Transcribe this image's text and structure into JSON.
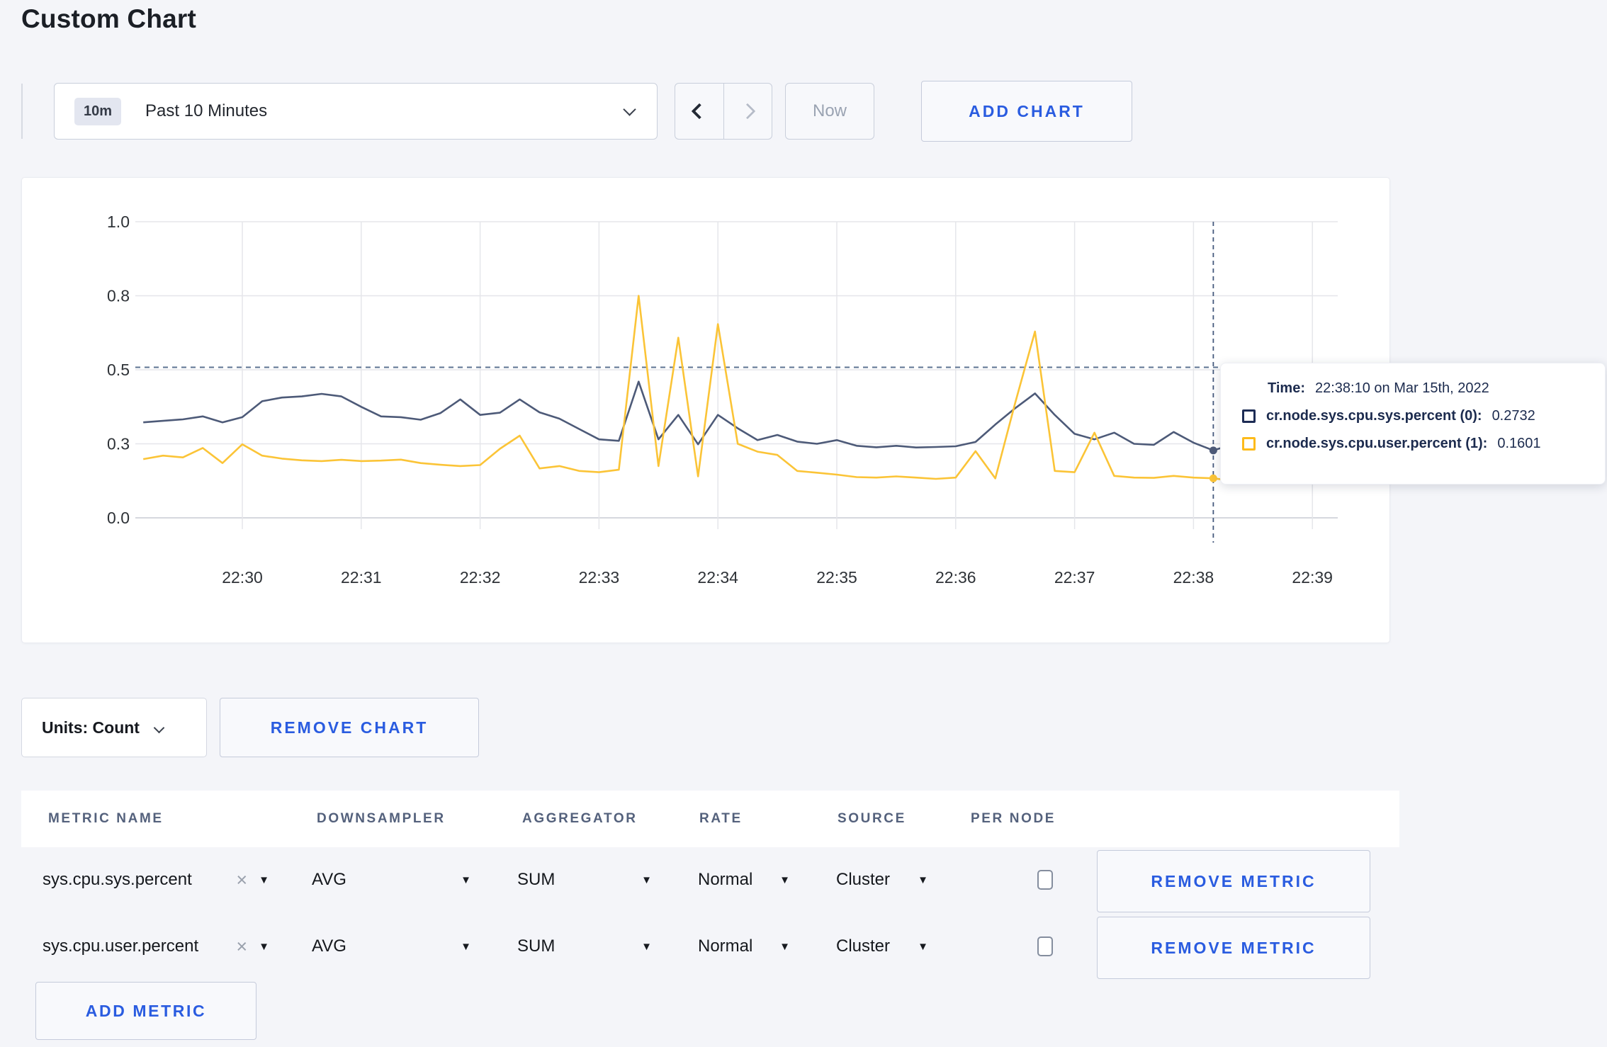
{
  "page": {
    "title": "Custom Chart"
  },
  "toolbar": {
    "time_window_badge": "10m",
    "time_window_label": "Past 10 Minutes",
    "now_label": "Now",
    "add_chart_label": "ADD CHART"
  },
  "tooltip": {
    "time_label": "Time:",
    "time_value": "22:38:10 on Mar 15th, 2022",
    "rows": [
      {
        "name": "cr.node.sys.cpu.sys.percent (0):",
        "value": "0.2732",
        "swatch": "#1d2c55"
      },
      {
        "name": "cr.node.sys.cpu.user.percent (1):",
        "value": "0.1601",
        "swatch": "#fdbb1b"
      }
    ]
  },
  "chart_controls": {
    "units_label": "Units: Count",
    "remove_chart_label": "REMOVE CHART"
  },
  "metrics_table": {
    "columns": [
      "Metric Name",
      "Downsampler",
      "Aggregator",
      "Rate",
      "Source",
      "Per Node"
    ],
    "rows": [
      {
        "metric": "sys.cpu.sys.percent",
        "downsampler": "AVG",
        "aggregator": "SUM",
        "rate": "Normal",
        "source": "Cluster",
        "per_node_checked": false,
        "remove_label": "REMOVE METRIC"
      },
      {
        "metric": "sys.cpu.user.percent",
        "downsampler": "AVG",
        "aggregator": "SUM",
        "rate": "Normal",
        "source": "Cluster",
        "per_node_checked": false,
        "remove_label": "REMOVE METRIC"
      }
    ],
    "add_metric_label": "ADD METRIC"
  },
  "chart_data": {
    "type": "line",
    "title": "",
    "xlabel": "",
    "ylabel": "",
    "grid": true,
    "y_ticks": [
      0.0,
      0.3,
      0.5,
      0.8,
      1.0
    ],
    "y_tick_labels": [
      "0.0",
      "0.3",
      "0.5",
      "0.8",
      "1.0"
    ],
    "x_tick_labels": [
      "22:30",
      "22:31",
      "22:32",
      "22:33",
      "22:34",
      "22:35",
      "22:36",
      "22:37",
      "22:38",
      "22:39"
    ],
    "start_time": "22:29:10",
    "interval_seconds": 10,
    "crosshair": {
      "time": "22:38:10",
      "y_value": 0.51
    },
    "series": [
      {
        "name": "cr.node.sys.cpu.sys.percent",
        "color": "#4d5a78",
        "values": [
          0.358,
          0.362,
          0.366,
          0.374,
          0.358,
          0.372,
          0.415,
          0.425,
          0.428,
          0.435,
          0.428,
          0.4,
          0.374,
          0.372,
          0.365,
          0.383,
          0.42,
          0.378,
          0.384,
          0.42,
          0.385,
          0.368,
          0.34,
          0.312,
          0.308,
          0.468,
          0.312,
          0.378,
          0.298,
          0.378,
          0.342,
          0.31,
          0.324,
          0.306,
          0.3,
          0.31,
          0.292,
          0.286,
          0.292,
          0.285,
          0.287,
          0.29,
          0.305,
          0.352,
          0.396,
          0.436,
          0.378,
          0.327,
          0.312,
          0.33,
          0.3,
          0.296,
          0.332,
          0.303,
          0.2732,
          0.298,
          0.292,
          0.3,
          0.312,
          0.315,
          0.3
        ]
      },
      {
        "name": "cr.node.sys.cpu.user.percent",
        "color": "#fbc437",
        "values": [
          0.238,
          0.252,
          0.245,
          0.283,
          0.222,
          0.298,
          0.252,
          0.24,
          0.233,
          0.23,
          0.235,
          0.23,
          0.232,
          0.236,
          0.222,
          0.215,
          0.21,
          0.214,
          0.28,
          0.322,
          0.2,
          0.21,
          0.19,
          0.185,
          0.195,
          0.8,
          0.21,
          0.63,
          0.168,
          0.685,
          0.3,
          0.268,
          0.255,
          0.19,
          0.183,
          0.175,
          0.165,
          0.163,
          0.168,
          0.163,
          0.158,
          0.163,
          0.27,
          0.16,
          0.41,
          0.655,
          0.19,
          0.185,
          0.33,
          0.17,
          0.163,
          0.162,
          0.17,
          0.163,
          0.1601,
          0.15,
          0.147,
          0.238,
          0.25,
          0.3,
          0.26
        ]
      }
    ]
  },
  "colors": {
    "accent_blue": "#2a5ce0",
    "page_bg": "#f4f5f9",
    "gridline": "#e5e6ea"
  }
}
